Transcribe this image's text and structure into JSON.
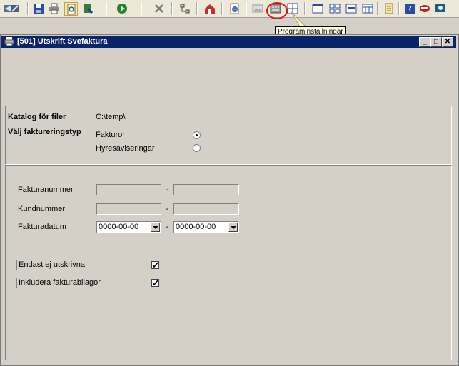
{
  "toolbar": {
    "icons": [
      "undo-icon",
      "redo-icon",
      "save-icon",
      "print-icon",
      "print-preview-icon",
      "export-icon",
      "run-icon",
      "tools-icon",
      "tree-icon",
      "house-up-icon",
      "globe-icon",
      "image-icon",
      "program-settings-icon",
      "zoom-grid-icon",
      "window-icon",
      "tile-icon",
      "form-icon",
      "calendar-icon",
      "notes-icon",
      "help-icon",
      "mail-icon",
      "screen-icon"
    ],
    "tooltip": "Programinställningar"
  },
  "window": {
    "title": "[501]  Utskrift Svefaktura",
    "controls": {
      "minimize": "_",
      "maximize": "□",
      "close": "✕"
    }
  },
  "files": {
    "catalog_label": "Katalog för filer",
    "catalog_value": "C:\\temp\\",
    "type_label": "Välj faktureringstyp",
    "options": [
      {
        "label": "Fakturor",
        "selected": true
      },
      {
        "label": "Hyresaviseringar",
        "selected": false
      }
    ]
  },
  "filters": {
    "invoice_number_label": "Fakturanummer",
    "customer_number_label": "Kundnummer",
    "invoice_date_label": "Fakturadatum",
    "invoice_number_from": "",
    "invoice_number_to": "",
    "customer_number_from": "",
    "customer_number_to": "",
    "date_from": "0000-00-00",
    "date_to": "0000-00-00",
    "separator": "-"
  },
  "checkboxes": [
    {
      "label": "Endast ej utskrivna",
      "checked": true
    },
    {
      "label": "Inkludera fakturabilagor",
      "checked": true
    }
  ]
}
